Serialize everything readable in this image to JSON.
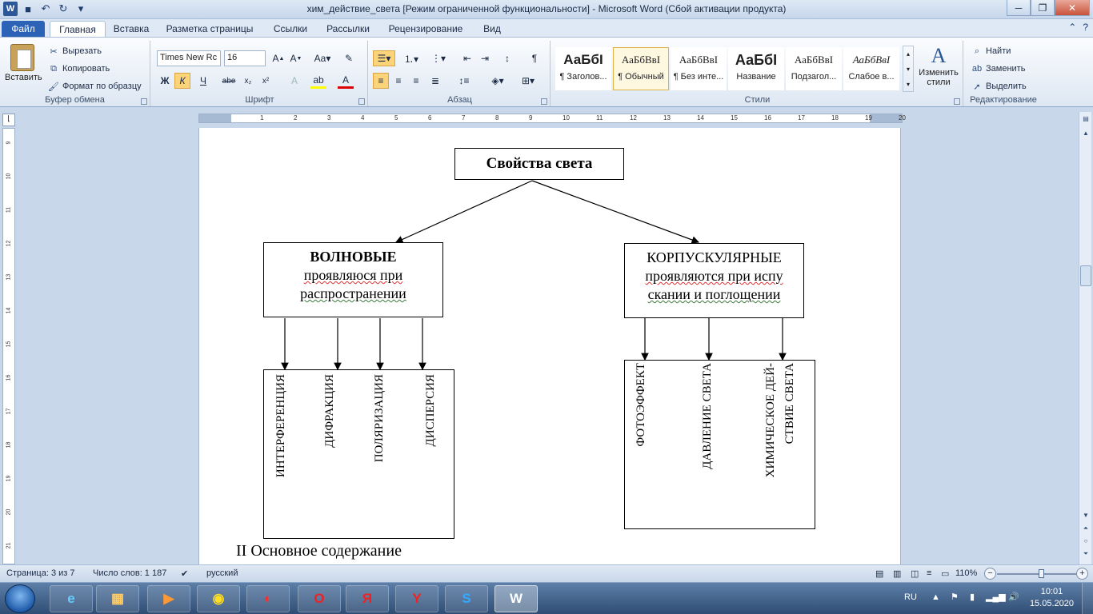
{
  "window": {
    "title": "хим_действие_света [Режим ограниченной функциональности]  -  Microsoft Word (Сбой активации продукта)"
  },
  "tabs": [
    {
      "label": "Файл"
    },
    {
      "label": "Главная"
    },
    {
      "label": "Вставка"
    },
    {
      "label": "Разметка страницы"
    },
    {
      "label": "Ссылки"
    },
    {
      "label": "Рассылки"
    },
    {
      "label": "Рецензирование"
    },
    {
      "label": "Вид"
    }
  ],
  "ribbon": {
    "clipboard": {
      "paste_label": "Вставить",
      "cut_label": "Вырезать",
      "copy_label": "Копировать",
      "format_painter_label": "Формат по образцу",
      "group_label": "Буфер обмена"
    },
    "font": {
      "font_name": "Times New Rc",
      "font_size": "16",
      "bold_glyph": "Ж",
      "italic_glyph": "К",
      "underline_glyph": "Ч",
      "strike_glyph": "abe",
      "group_label": "Шрифт"
    },
    "paragraph": {
      "group_label": "Абзац"
    },
    "styles": {
      "items": [
        {
          "sample": "АаБбІ",
          "name": "¶ Заголов..."
        },
        {
          "sample": "АаБбВвІ",
          "name": "¶ Обычный"
        },
        {
          "sample": "АаБбВвІ",
          "name": "¶ Без инте..."
        },
        {
          "sample": "АаБбІ",
          "name": "Название"
        },
        {
          "sample": "АаБбВвІ",
          "name": "Подзагол..."
        },
        {
          "sample": "АаБбВвІ",
          "name": "Слабое в..."
        }
      ],
      "change_styles_label": "Изменить стили",
      "group_label": "Стили"
    },
    "editing": {
      "find_label": "Найти",
      "replace_label": "Заменить",
      "select_label": "Выделить",
      "group_label": "Редактирование"
    }
  },
  "ruler": {
    "ticks": [
      "1",
      "2",
      "3",
      "4",
      "5",
      "6",
      "7",
      "8",
      "9",
      "10",
      "11",
      "12",
      "13",
      "14",
      "15",
      "16",
      "17",
      "18",
      "19",
      "20"
    ]
  },
  "vruler": {
    "ticks": [
      "9",
      "10",
      "11",
      "12",
      "13",
      "14",
      "15",
      "16",
      "17",
      "18",
      "19",
      "20",
      "21"
    ]
  },
  "document": {
    "root_box": "Свойства света",
    "wave_box": {
      "title": "ВОЛНОВЫЕ",
      "line1": "проявляюся при",
      "line2": "распространении"
    },
    "corp_box": {
      "title": "КОРПУСКУЛЯРНЫЕ",
      "line1": "проявляются при испу",
      "line2": "скании и поглощении"
    },
    "wave_items": [
      "ИНТЕРФЕРЕНЦИЯ",
      "ДИФРАКЦИЯ",
      "ПОЛЯРИЗАЦИЯ",
      "ДИСПЕРСИЯ"
    ],
    "corp_items": [
      "ФОТОЭФФЕКТ",
      "ДАВЛЕНИЕ СВЕТА",
      "ХИМИЧЕСКОЕ ДЕЙ-",
      "СТВИЕ СВЕТА"
    ],
    "heading": "II Основное содержание"
  },
  "statusbar": {
    "page": "Страница: 3 из 7",
    "words": "Число слов: 1 187",
    "language": "русский",
    "zoom": "110%"
  },
  "taskbar": {
    "language": "RU",
    "time": "10:01",
    "date": "15.05.2020"
  }
}
